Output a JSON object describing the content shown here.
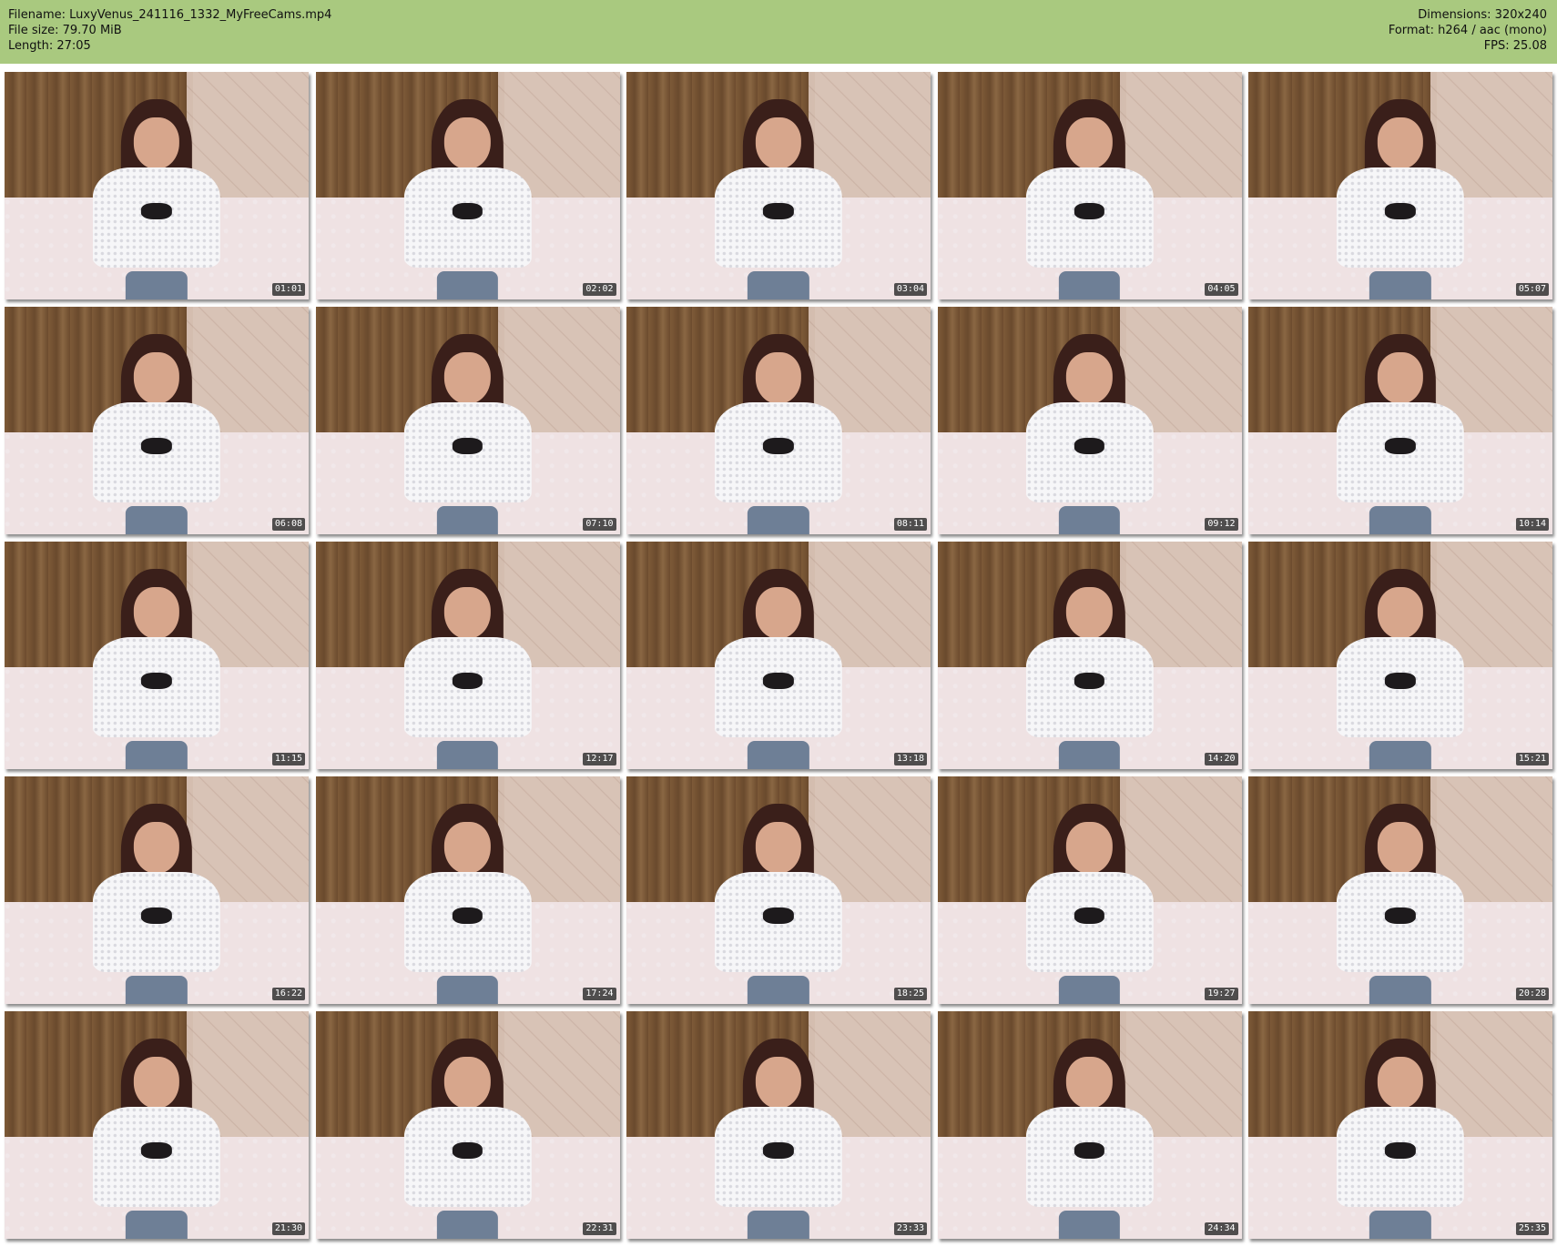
{
  "header": {
    "background": "#a9c97f",
    "left": [
      "Filename: LuxyVenus_241116_1332_MyFreeCams.mp4",
      "File size: 79.70 MiB",
      "Length: 27:05"
    ],
    "right": [
      "Dimensions: 320x240",
      "Format: h264 / aac (mono)",
      "FPS: 25.08"
    ]
  },
  "thumbnails": [
    {
      "time": "01:01"
    },
    {
      "time": "02:02"
    },
    {
      "time": "03:04"
    },
    {
      "time": "04:05"
    },
    {
      "time": "05:07"
    },
    {
      "time": "06:08"
    },
    {
      "time": "07:10"
    },
    {
      "time": "08:11"
    },
    {
      "time": "09:12"
    },
    {
      "time": "10:14"
    },
    {
      "time": "11:15"
    },
    {
      "time": "12:17"
    },
    {
      "time": "13:18"
    },
    {
      "time": "14:20"
    },
    {
      "time": "15:21"
    },
    {
      "time": "16:22"
    },
    {
      "time": "17:24"
    },
    {
      "time": "18:25"
    },
    {
      "time": "19:27"
    },
    {
      "time": "20:28"
    },
    {
      "time": "21:30"
    },
    {
      "time": "22:31"
    },
    {
      "time": "23:33"
    },
    {
      "time": "24:34"
    },
    {
      "time": "25:35"
    }
  ]
}
